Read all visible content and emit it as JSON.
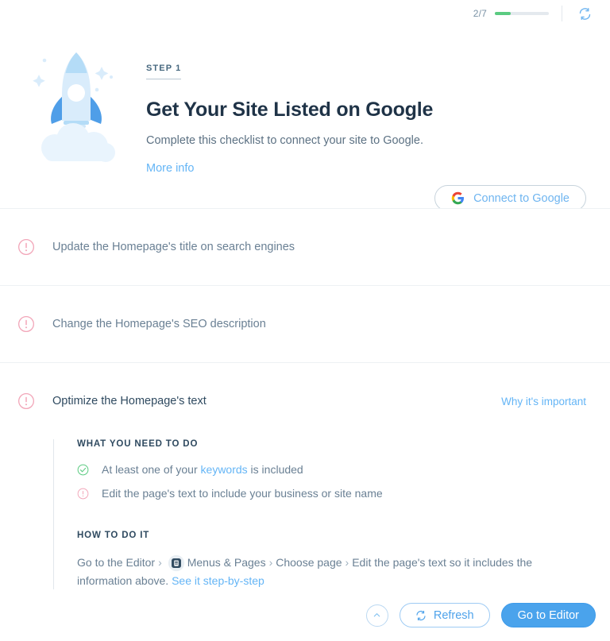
{
  "topbar": {
    "progress_text": "2/7",
    "progress_percent": 29,
    "progress_fill_color": "#5bcb81",
    "refresh_icon": "refresh-icon"
  },
  "hero": {
    "illustration": "rocket-illustration",
    "step_label": "STEP 1",
    "title": "Get Your Site Listed on Google",
    "subtitle": "Complete this checklist to connect your site to Google.",
    "more_info_label": "More info",
    "connect_button": {
      "label": "Connect to Google",
      "icon": "google-g-icon"
    }
  },
  "checklist": {
    "items": [
      {
        "status_icon": "warning-icon",
        "label": "Update the Homepage's title on search engines",
        "expanded": false
      },
      {
        "status_icon": "warning-icon",
        "label": "Change the Homepage's SEO description",
        "expanded": false
      },
      {
        "status_icon": "warning-icon",
        "label": "Optimize the Homepage's text",
        "right_link": "Why it's important",
        "expanded": true
      }
    ]
  },
  "expanded_panel": {
    "what_heading": "WHAT YOU NEED TO DO",
    "requirements": [
      {
        "icon": "check-circle-icon",
        "text_before": "At least one of your ",
        "link": "keywords",
        "text_after": " is included"
      },
      {
        "icon": "warning-icon",
        "text_before": "Edit the page's text to include your business or site name",
        "link": "",
        "text_after": ""
      }
    ],
    "how_heading": "HOW TO DO IT",
    "how_steps": {
      "part1": "Go to the Editor",
      "sep1": "›",
      "icon": "menus-pages-icon",
      "part2": "Menus & Pages",
      "sep2": "›",
      "part3": "Choose page",
      "sep3": "›",
      "part4": "Edit the page's text so it includes the information above.",
      "link": "See it step-by-step"
    }
  },
  "footer": {
    "collapse_button_icon": "chevron-up-icon",
    "refresh_button": {
      "label": "Refresh",
      "icon": "refresh-icon"
    },
    "editor_button": {
      "label": "Go to Editor"
    }
  },
  "colors": {
    "accent_blue": "#4aa3ec",
    "link_blue": "#64b5f6",
    "warning_pink": "#f2a5b8",
    "success_green": "#5bcb81",
    "title_dark": "#1f3347"
  }
}
